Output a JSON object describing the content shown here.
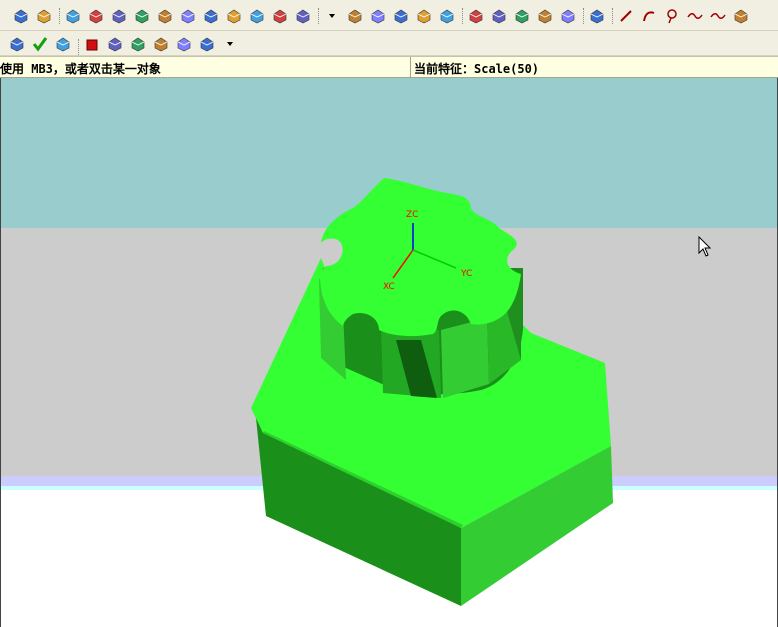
{
  "toolbar": {
    "row1_icons": [
      "point-cloud-icon",
      "sphere-icon",
      "block-icon",
      "extrude-icon",
      "revolve-icon",
      "swept-icon",
      "cylinder-icon",
      "tube-icon",
      "slab-icon",
      "box-icon",
      "shell-icon",
      "face-icon",
      "plane-icon",
      "more-arrows-icon",
      "sheet-icon",
      "sweep-face-icon",
      "blend-icon",
      "chamfer-icon",
      "draft-icon",
      "pattern-icon",
      "offset-face-icon",
      "mirror-icon",
      "trim-icon",
      "sew-icon",
      "color-icon",
      "line-icon",
      "arc-icon",
      "circle-icon",
      "spline-icon",
      "curve-icon",
      "sketch-icon"
    ],
    "row2_icons": [
      "datum-icon",
      "check-icon",
      "table-icon",
      "cube-red-icon",
      "mold-icon",
      "move-icon",
      "scale-icon",
      "edit-icon",
      "transform-icon",
      "dropdown-icon"
    ]
  },
  "status": {
    "prompt": "使用 MB3，或者双击某一对象",
    "feature": "当前特征：Scale(50)"
  },
  "axes": {
    "zc": "ZC",
    "xc": "XC",
    "yc": "YC"
  },
  "colors": {
    "background_top": "#99cccc",
    "background_middle": "#cccccc",
    "background_band": "#ccccff",
    "model_light": "#33ff33",
    "model_medium": "#33cc33",
    "model_dark": "#1a8f1a",
    "axis_z": "#0000ff",
    "axis_x": "#ff0000",
    "axis_y": "#ff0000"
  }
}
